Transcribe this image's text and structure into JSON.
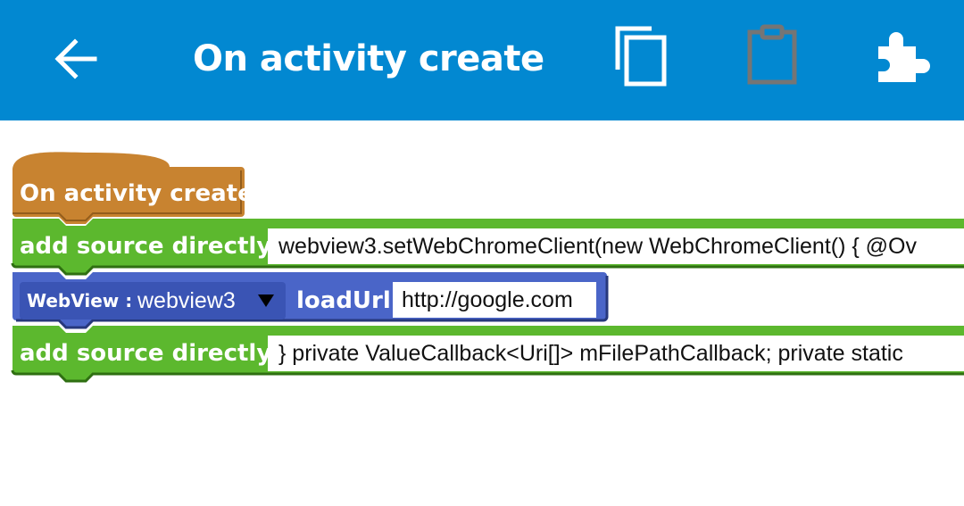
{
  "header": {
    "title": "On activity create",
    "icons": {
      "back": "arrow-left-icon",
      "copy": "copy-icon",
      "paste": "clipboard-icon",
      "components": "puzzle-icon"
    },
    "colors": {
      "appbar": "#0288d1",
      "paste_disabled": "#757575"
    }
  },
  "blocks": {
    "event": {
      "label": "On activity create",
      "color": "#c88330"
    },
    "add_source_1": {
      "label": "add source directly",
      "value": "webview3.setWebChromeClient(new WebChromeClient() { @Ov",
      "color": "#5cb82e"
    },
    "webview_loadurl": {
      "type_label": "WebView :",
      "selected": "webview3",
      "method": "loadUrl",
      "url": "http://google.com",
      "color": "#4a65c8"
    },
    "add_source_2": {
      "label": "add source directly",
      "value": "} private ValueCallback<Uri[]> mFilePathCallback; private static",
      "color": "#5cb82e"
    }
  }
}
